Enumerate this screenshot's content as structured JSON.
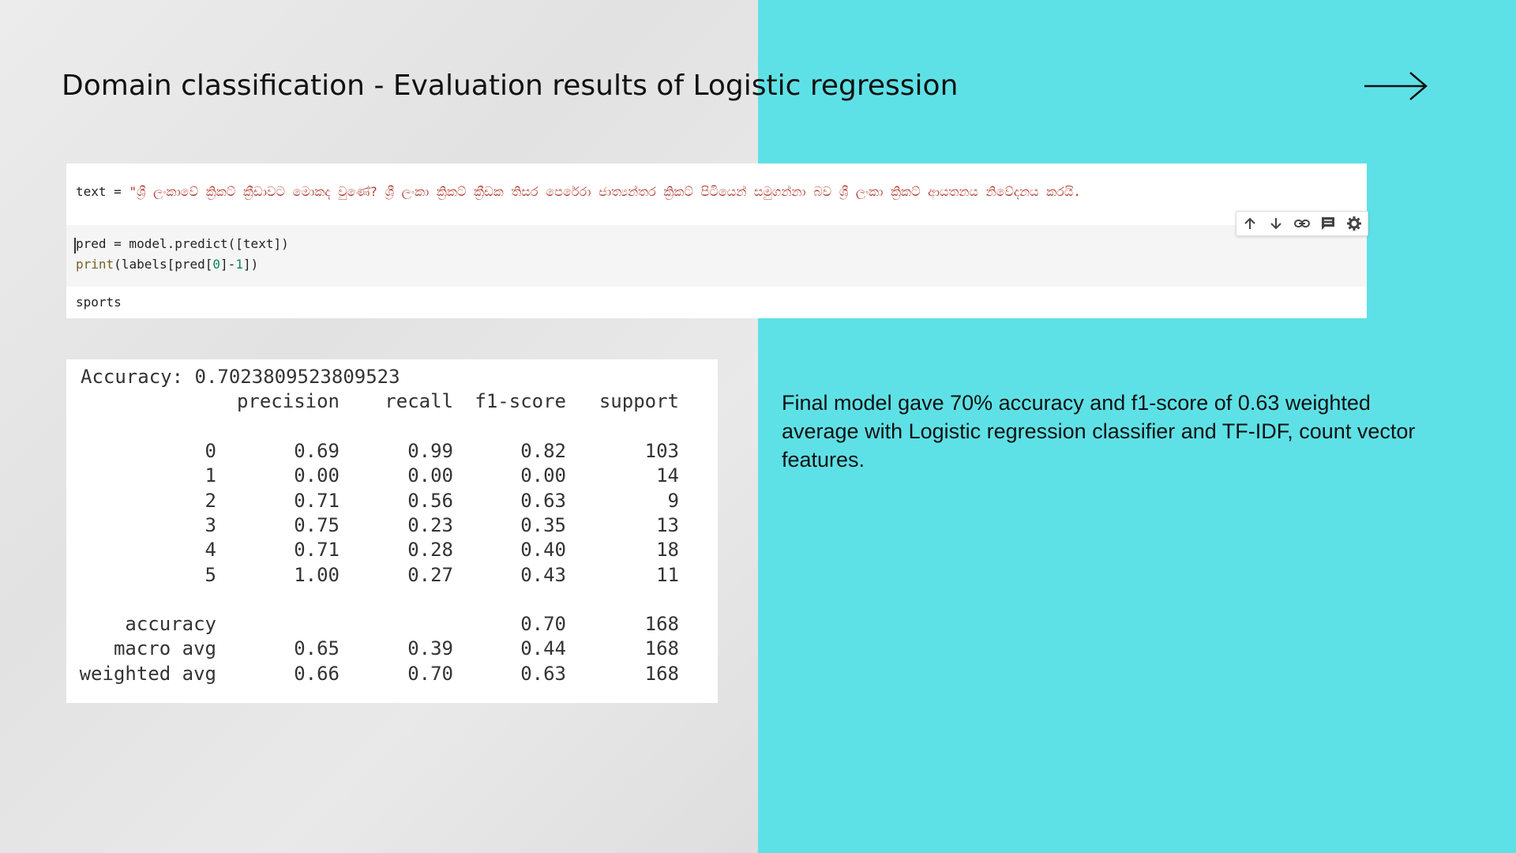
{
  "slide": {
    "title": "Domain classification - Evaluation results of Logistic regression",
    "next_arrow_icon": "long-arrow-right-icon",
    "accent_color": "#5ee1e6"
  },
  "notebook": {
    "text_var": "text = ",
    "text_value": "\"ශ්‍රී ලංකාවේ ක්‍රිකට් ක්‍රීඩාවට මොකද වුණේ? ශ්‍රී ලංකා ක්‍රිකට් ක්‍රීඩක තිසර පෙරේරා ජාත්‍යන්තර ක්‍රිකට් පිටියෙන් සමුගන්නා බව ශ්‍රී ලංකා ක්‍රිකට් ආයතනය නිවේදනය කරයි.",
    "code_line1": "pred = model.predict([text])",
    "code_line2_kw": "print",
    "code_line2_a": "(labels[pred[",
    "code_line2_num0": "0",
    "code_line2_b": "]-",
    "code_line2_num1": "1",
    "code_line2_c": "])",
    "output": "sports",
    "toolbar_icons": [
      "arrow-up-icon",
      "arrow-down-icon",
      "link-icon",
      "comment-icon",
      "gear-icon"
    ]
  },
  "report": {
    "accuracy_line": "Accuracy: 0.7023809523809523",
    "headers": [
      "precision",
      "recall",
      "f1-score",
      "support"
    ],
    "rows": [
      {
        "label": "0",
        "precision": "0.69",
        "recall": "0.99",
        "f1": "0.82",
        "support": "103"
      },
      {
        "label": "1",
        "precision": "0.00",
        "recall": "0.00",
        "f1": "0.00",
        "support": "14"
      },
      {
        "label": "2",
        "precision": "0.71",
        "recall": "0.56",
        "f1": "0.63",
        "support": "9"
      },
      {
        "label": "3",
        "precision": "0.75",
        "recall": "0.23",
        "f1": "0.35",
        "support": "13"
      },
      {
        "label": "4",
        "precision": "0.71",
        "recall": "0.28",
        "f1": "0.40",
        "support": "18"
      },
      {
        "label": "5",
        "precision": "1.00",
        "recall": "0.27",
        "f1": "0.43",
        "support": "11"
      }
    ],
    "summary_rows": [
      {
        "label": "accuracy",
        "precision": "",
        "recall": "",
        "f1": "0.70",
        "support": "168"
      },
      {
        "label": "macro avg",
        "precision": "0.65",
        "recall": "0.39",
        "f1": "0.44",
        "support": "168"
      },
      {
        "label": "weighted avg",
        "precision": "0.66",
        "recall": "0.70",
        "f1": "0.63",
        "support": "168"
      }
    ]
  },
  "summary_text": "Final model gave 70% accuracy and f1-score of 0.63 weighted average with Logistic regression classifier and TF-IDF, count vector features."
}
